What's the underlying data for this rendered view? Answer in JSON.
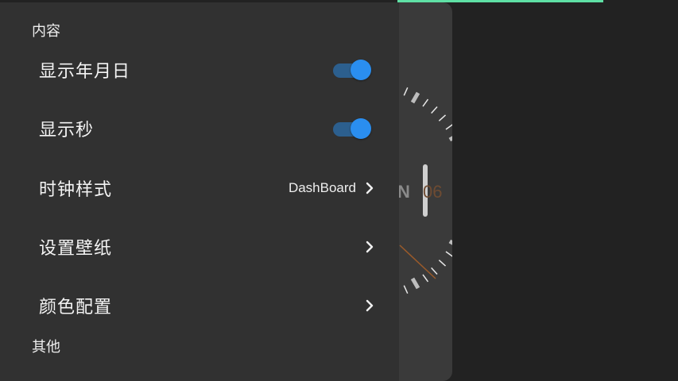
{
  "sections": {
    "content_title": "内容",
    "other_title": "其他"
  },
  "items": [
    {
      "label": "显示年月日",
      "control": "toggle",
      "checked": true
    },
    {
      "label": "显示秒",
      "control": "toggle",
      "checked": true
    },
    {
      "label": "时钟样式",
      "control": "link",
      "value": "DashBoard"
    },
    {
      "label": "设置壁纸",
      "control": "link"
    },
    {
      "label": "颜色配置",
      "control": "link"
    }
  ],
  "clock_preview": {
    "letter": "N",
    "number": "06"
  },
  "colors": {
    "background": "#222222",
    "panel": "#313131",
    "accent": "#2a8ef0",
    "top_bar": "#5fe0a5"
  }
}
